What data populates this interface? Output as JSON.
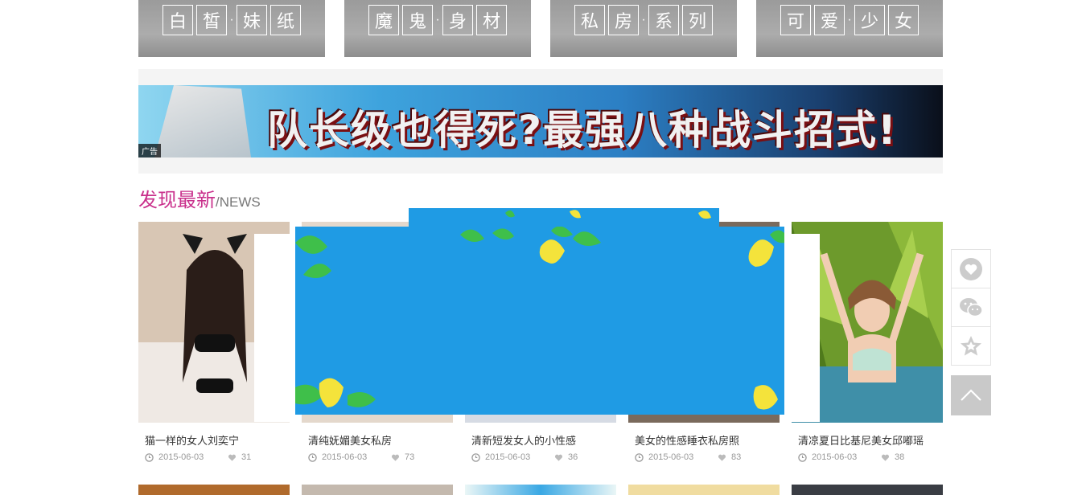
{
  "categories": [
    {
      "chars": [
        "白",
        "皙",
        "妹",
        "纸"
      ],
      "dot": "·"
    },
    {
      "chars": [
        "魔",
        "鬼",
        "身",
        "材"
      ],
      "dot": "·"
    },
    {
      "chars": [
        "私",
        "房",
        "系",
        "列"
      ],
      "dot": "·"
    },
    {
      "chars": [
        "可",
        "爱",
        "少",
        "女"
      ],
      "dot": "·"
    }
  ],
  "ad": {
    "slogan": "队长级也得死?最强八种战斗招式!",
    "tag": "广告"
  },
  "section": {
    "title_cn": "发现最新",
    "title_en": "/NEWS"
  },
  "news": [
    {
      "title": "猫一样的女人刘奕宁",
      "date": "2015-06-03",
      "likes": "31"
    },
    {
      "title": "清纯妩媚美女私房",
      "date": "2015-06-03",
      "likes": "73"
    },
    {
      "title": "清新短发女人的小性感",
      "date": "2015-06-03",
      "likes": "36"
    },
    {
      "title": "美女的性感睡衣私房照",
      "date": "2015-06-03",
      "likes": "83"
    },
    {
      "title": "清凉夏日比基尼美女邱嘟瑶",
      "date": "2015-06-03",
      "likes": "38"
    }
  ],
  "sidebar": {
    "icons": [
      "heart-icon",
      "wechat-icon",
      "star-icon",
      "back-to-top-icon"
    ]
  },
  "colors": {
    "accent": "#c9318c",
    "overlay_blue": "#1f9be4",
    "leaf_yellow": "#f4e33b",
    "leaf_green": "#3fbf4a"
  }
}
